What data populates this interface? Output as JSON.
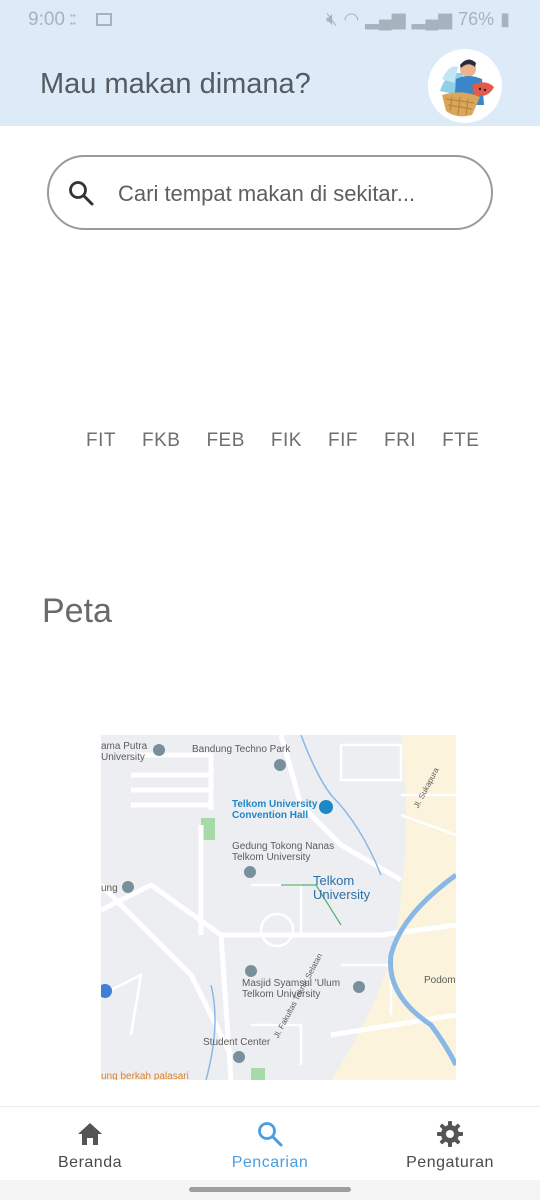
{
  "status_bar": {
    "time": "9:00",
    "battery": "76%"
  },
  "header": {
    "title": "Mau makan dimana?"
  },
  "search": {
    "placeholder": "Cari tempat makan di sekitar..."
  },
  "chips": [
    "FIT",
    "FKB",
    "FEB",
    "FIK",
    "FIF",
    "FRI",
    "FTE"
  ],
  "map_section": {
    "title": "Peta",
    "labels": {
      "l1": "ama Putra",
      "l1b": "University",
      "l2": "Bandung Techno Park",
      "l3": "Telkom University",
      "l3b": "Convention Hall",
      "l4": "Gedung Tokong Nanas",
      "l4b": "Telkom University",
      "l5": "Telkom",
      "l5b": "University",
      "l6": "ung",
      "l7": "Masjid Syamsul 'Ulum",
      "l7b": "Telkom University",
      "l8": "Student Center",
      "l9": "Jl. Fakultas Teknik Selatan",
      "l10": "Jl. Sukapura",
      "l11": "Podom",
      "l12": "ung berkah palasari"
    }
  },
  "bottom_nav": {
    "items": [
      {
        "label": "Beranda",
        "icon": "home-icon"
      },
      {
        "label": "Pencarian",
        "icon": "search-icon"
      },
      {
        "label": "Pengaturan",
        "icon": "gear-icon"
      }
    ],
    "active": "Pencarian"
  },
  "colors": {
    "header_bg": "#ddebf8",
    "accent": "#4a9ee0"
  }
}
